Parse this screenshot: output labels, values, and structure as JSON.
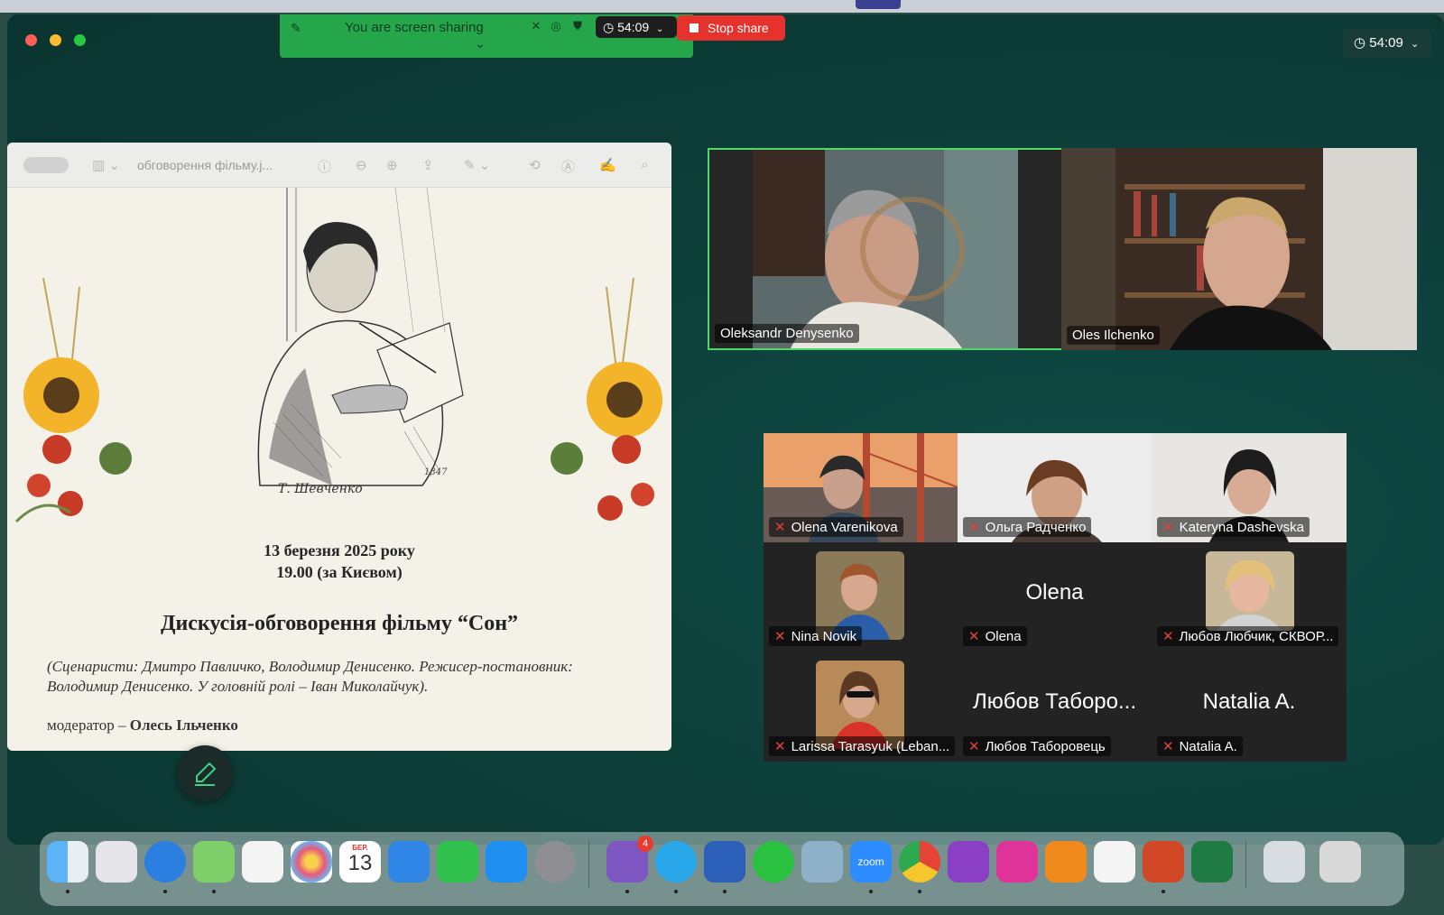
{
  "share_bar": {
    "status": "You are screen sharing",
    "timer": "54:09",
    "stop_label": "Stop share"
  },
  "meeting_timer": "54:09",
  "document": {
    "filename": "обговорення фільму.j...",
    "date_line": "13 березня 2025 року",
    "time_line": "19.00 (за Києвом)",
    "title": "Дискусія-обговорення фільму “Сон”",
    "credits": "(Сценаристи: Дмитро Павличко, Володимир Денисенко. Режисер-постановник: Володимир Денисенко. У головній ролі – Іван Миколайчук).",
    "moderator_label": "модератор – ",
    "moderator_name": "Олесь Ільченко",
    "sketch_signature": "Т. Шевченко",
    "sketch_year": "1847"
  },
  "speakers": [
    {
      "name": "Oleksandr Denysenko",
      "active": true
    },
    {
      "name": "Oles Ilchenko",
      "active": false
    }
  ],
  "gallery": [
    {
      "name": "Olena Varenikova",
      "muted": true,
      "video": true
    },
    {
      "name": "Ольга Радченко",
      "muted": true,
      "video": true
    },
    {
      "name": "Kateryna Dashevska",
      "muted": true,
      "video": true
    },
    {
      "name": "Nina Novik",
      "muted": true,
      "video": true
    },
    {
      "name": "Olena",
      "display": "Olena",
      "muted": true,
      "video": false
    },
    {
      "name": "Любов Любчик, СКВОР...",
      "muted": true,
      "video": true
    },
    {
      "name": "Larissa Tarasyuk (Leban...",
      "muted": true,
      "video": true
    },
    {
      "name": "Любов Таборовець",
      "display": "Любов Таборо...",
      "muted": true,
      "video": false
    },
    {
      "name": "Natalia A.",
      "display": "Natalia A.",
      "muted": true,
      "video": false
    }
  ],
  "dock": {
    "calendar_month": "БЕР.",
    "calendar_day": "13",
    "viber_badge": "4",
    "zoom_label": "zoom",
    "apps": [
      "finder",
      "launchpad",
      "safari",
      "maps",
      "freeform",
      "photos",
      "calendar",
      "keynote",
      "numbers",
      "app-store",
      "system-settings",
      "viber",
      "telegram",
      "word",
      "whatsapp",
      "preview",
      "zoom",
      "chrome",
      "djvu",
      "chinese-app",
      "books",
      "sync",
      "powerpoint",
      "excel",
      "downloads",
      "trash"
    ]
  },
  "colors": {
    "share_green": "#25a64a",
    "stop_red": "#e5322c",
    "active_speaker_border": "#4cd964",
    "background": "#0e3f3a"
  }
}
